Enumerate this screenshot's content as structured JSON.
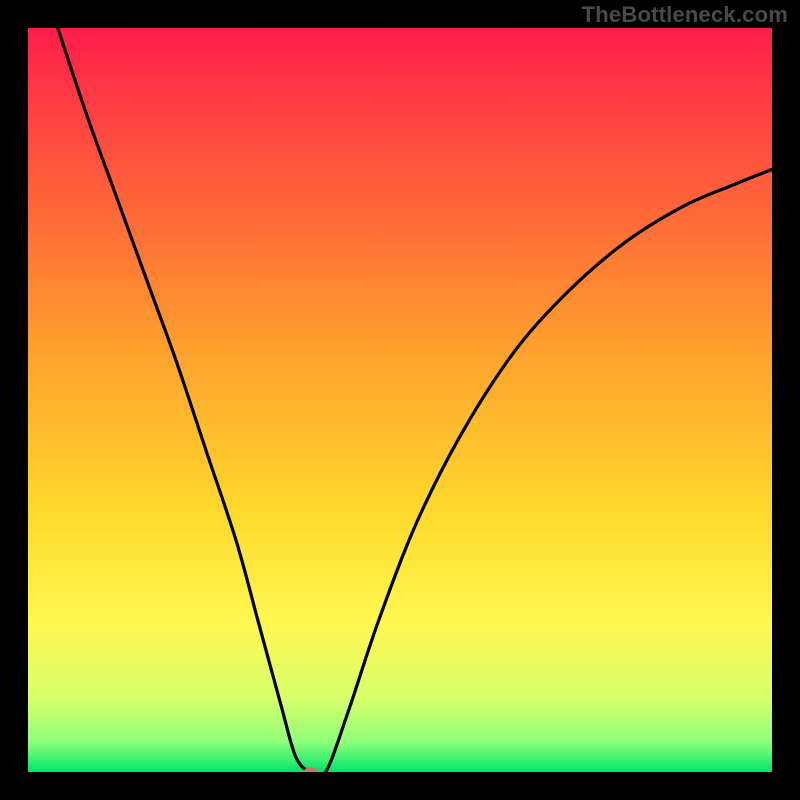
{
  "watermark": "TheBottleneck.com",
  "chart_data": {
    "type": "line",
    "title": "",
    "xlabel": "",
    "ylabel": "",
    "xlim": [
      0,
      100
    ],
    "ylim": [
      0,
      100
    ],
    "grid": false,
    "legend": false,
    "background_gradient_stops": [
      {
        "offset": 0.0,
        "color": "#ff1e4b"
      },
      {
        "offset": 0.2,
        "color": "#ff5a3c"
      },
      {
        "offset": 0.45,
        "color": "#ffa52c"
      },
      {
        "offset": 0.65,
        "color": "#ffd92c"
      },
      {
        "offset": 0.8,
        "color": "#fff850"
      },
      {
        "offset": 0.9,
        "color": "#d8ff6a"
      },
      {
        "offset": 0.96,
        "color": "#8dff7a"
      },
      {
        "offset": 1.0,
        "color": "#00e56b"
      }
    ],
    "marker": {
      "x": 38,
      "y": 0,
      "color": "#c77a63",
      "radius": 6
    },
    "series": [
      {
        "name": "bottleneck-curve",
        "color": "#000000",
        "points": [
          {
            "x": 4,
            "y": 100
          },
          {
            "x": 8,
            "y": 88
          },
          {
            "x": 12,
            "y": 77
          },
          {
            "x": 16,
            "y": 66
          },
          {
            "x": 20,
            "y": 55
          },
          {
            "x": 24,
            "y": 43
          },
          {
            "x": 28,
            "y": 31
          },
          {
            "x": 31,
            "y": 20
          },
          {
            "x": 34,
            "y": 9
          },
          {
            "x": 36,
            "y": 2
          },
          {
            "x": 38,
            "y": 0
          },
          {
            "x": 40,
            "y": 0
          },
          {
            "x": 43,
            "y": 8
          },
          {
            "x": 47,
            "y": 20
          },
          {
            "x": 52,
            "y": 33
          },
          {
            "x": 58,
            "y": 45
          },
          {
            "x": 65,
            "y": 56
          },
          {
            "x": 72,
            "y": 64
          },
          {
            "x": 80,
            "y": 71
          },
          {
            "x": 88,
            "y": 76
          },
          {
            "x": 95,
            "y": 79
          },
          {
            "x": 100,
            "y": 81
          }
        ]
      }
    ]
  }
}
